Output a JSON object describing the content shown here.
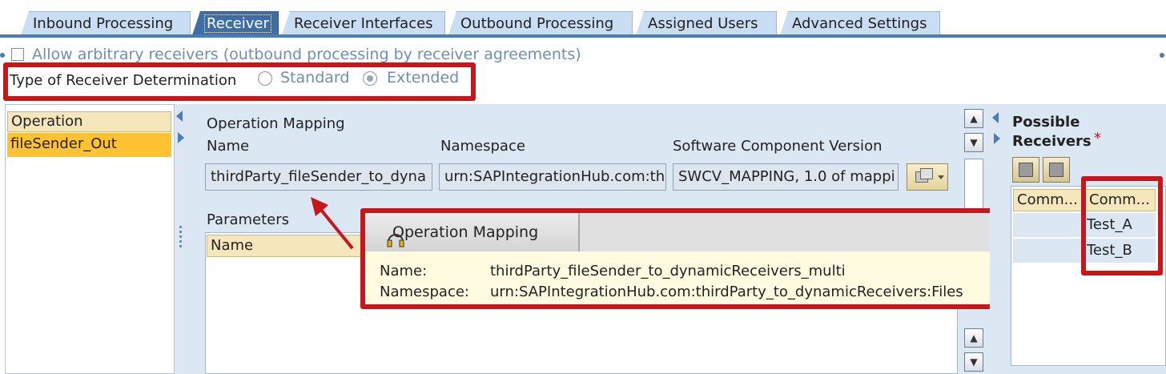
{
  "tabs": [
    {
      "label": "Inbound Processing",
      "active": false
    },
    {
      "label": "Receiver",
      "active": true
    },
    {
      "label": "Receiver Interfaces",
      "active": false
    },
    {
      "label": "Outbound Processing",
      "active": false
    },
    {
      "label": "Assigned Users",
      "active": false
    },
    {
      "label": "Advanced Settings",
      "active": false
    }
  ],
  "options": {
    "allow_arbitrary_label": "Allow arbitrary receivers (outbound processing by receiver agreements)",
    "type_label": "Type of Receiver Determination",
    "radio_standard": "Standard",
    "radio_extended": "Extended",
    "selected": "Extended"
  },
  "operations": {
    "header": "Operation",
    "items": [
      "fileSender_Out"
    ]
  },
  "mapping": {
    "section_title": "Operation Mapping",
    "name_label": "Name",
    "namespace_label": "Namespace",
    "swcv_label": "Software Component Version",
    "name_value": "thirdParty_fileSender_to_dyna",
    "namespace_value": "urn:SAPIntegrationHub.com:th",
    "swcv_value": "SWCV_MAPPING, 1.0 of mappi"
  },
  "parameters": {
    "section_title": "Parameters",
    "col_name": "Name"
  },
  "tooltip": {
    "title": "Operation Mapping",
    "name_label": "Name:",
    "name_value": "thirdParty_fileSender_to_dynamicReceivers_multi",
    "namespace_label": "Namespace:",
    "namespace_value": "urn:SAPIntegrationHub.com:thirdParty_to_dynamicReceivers:Files"
  },
  "receivers": {
    "title_line1": "Possible",
    "title_line2": "Receivers",
    "required_mark": "*",
    "col1": "Comm...",
    "col2": "Comm...",
    "rows": [
      "Test_A",
      "Test_B"
    ]
  },
  "colors": {
    "accent": "#3d6ea8",
    "highlight": "#c8161d",
    "selected_row": "#ffc233",
    "header_cell": "#f5e6bc"
  }
}
